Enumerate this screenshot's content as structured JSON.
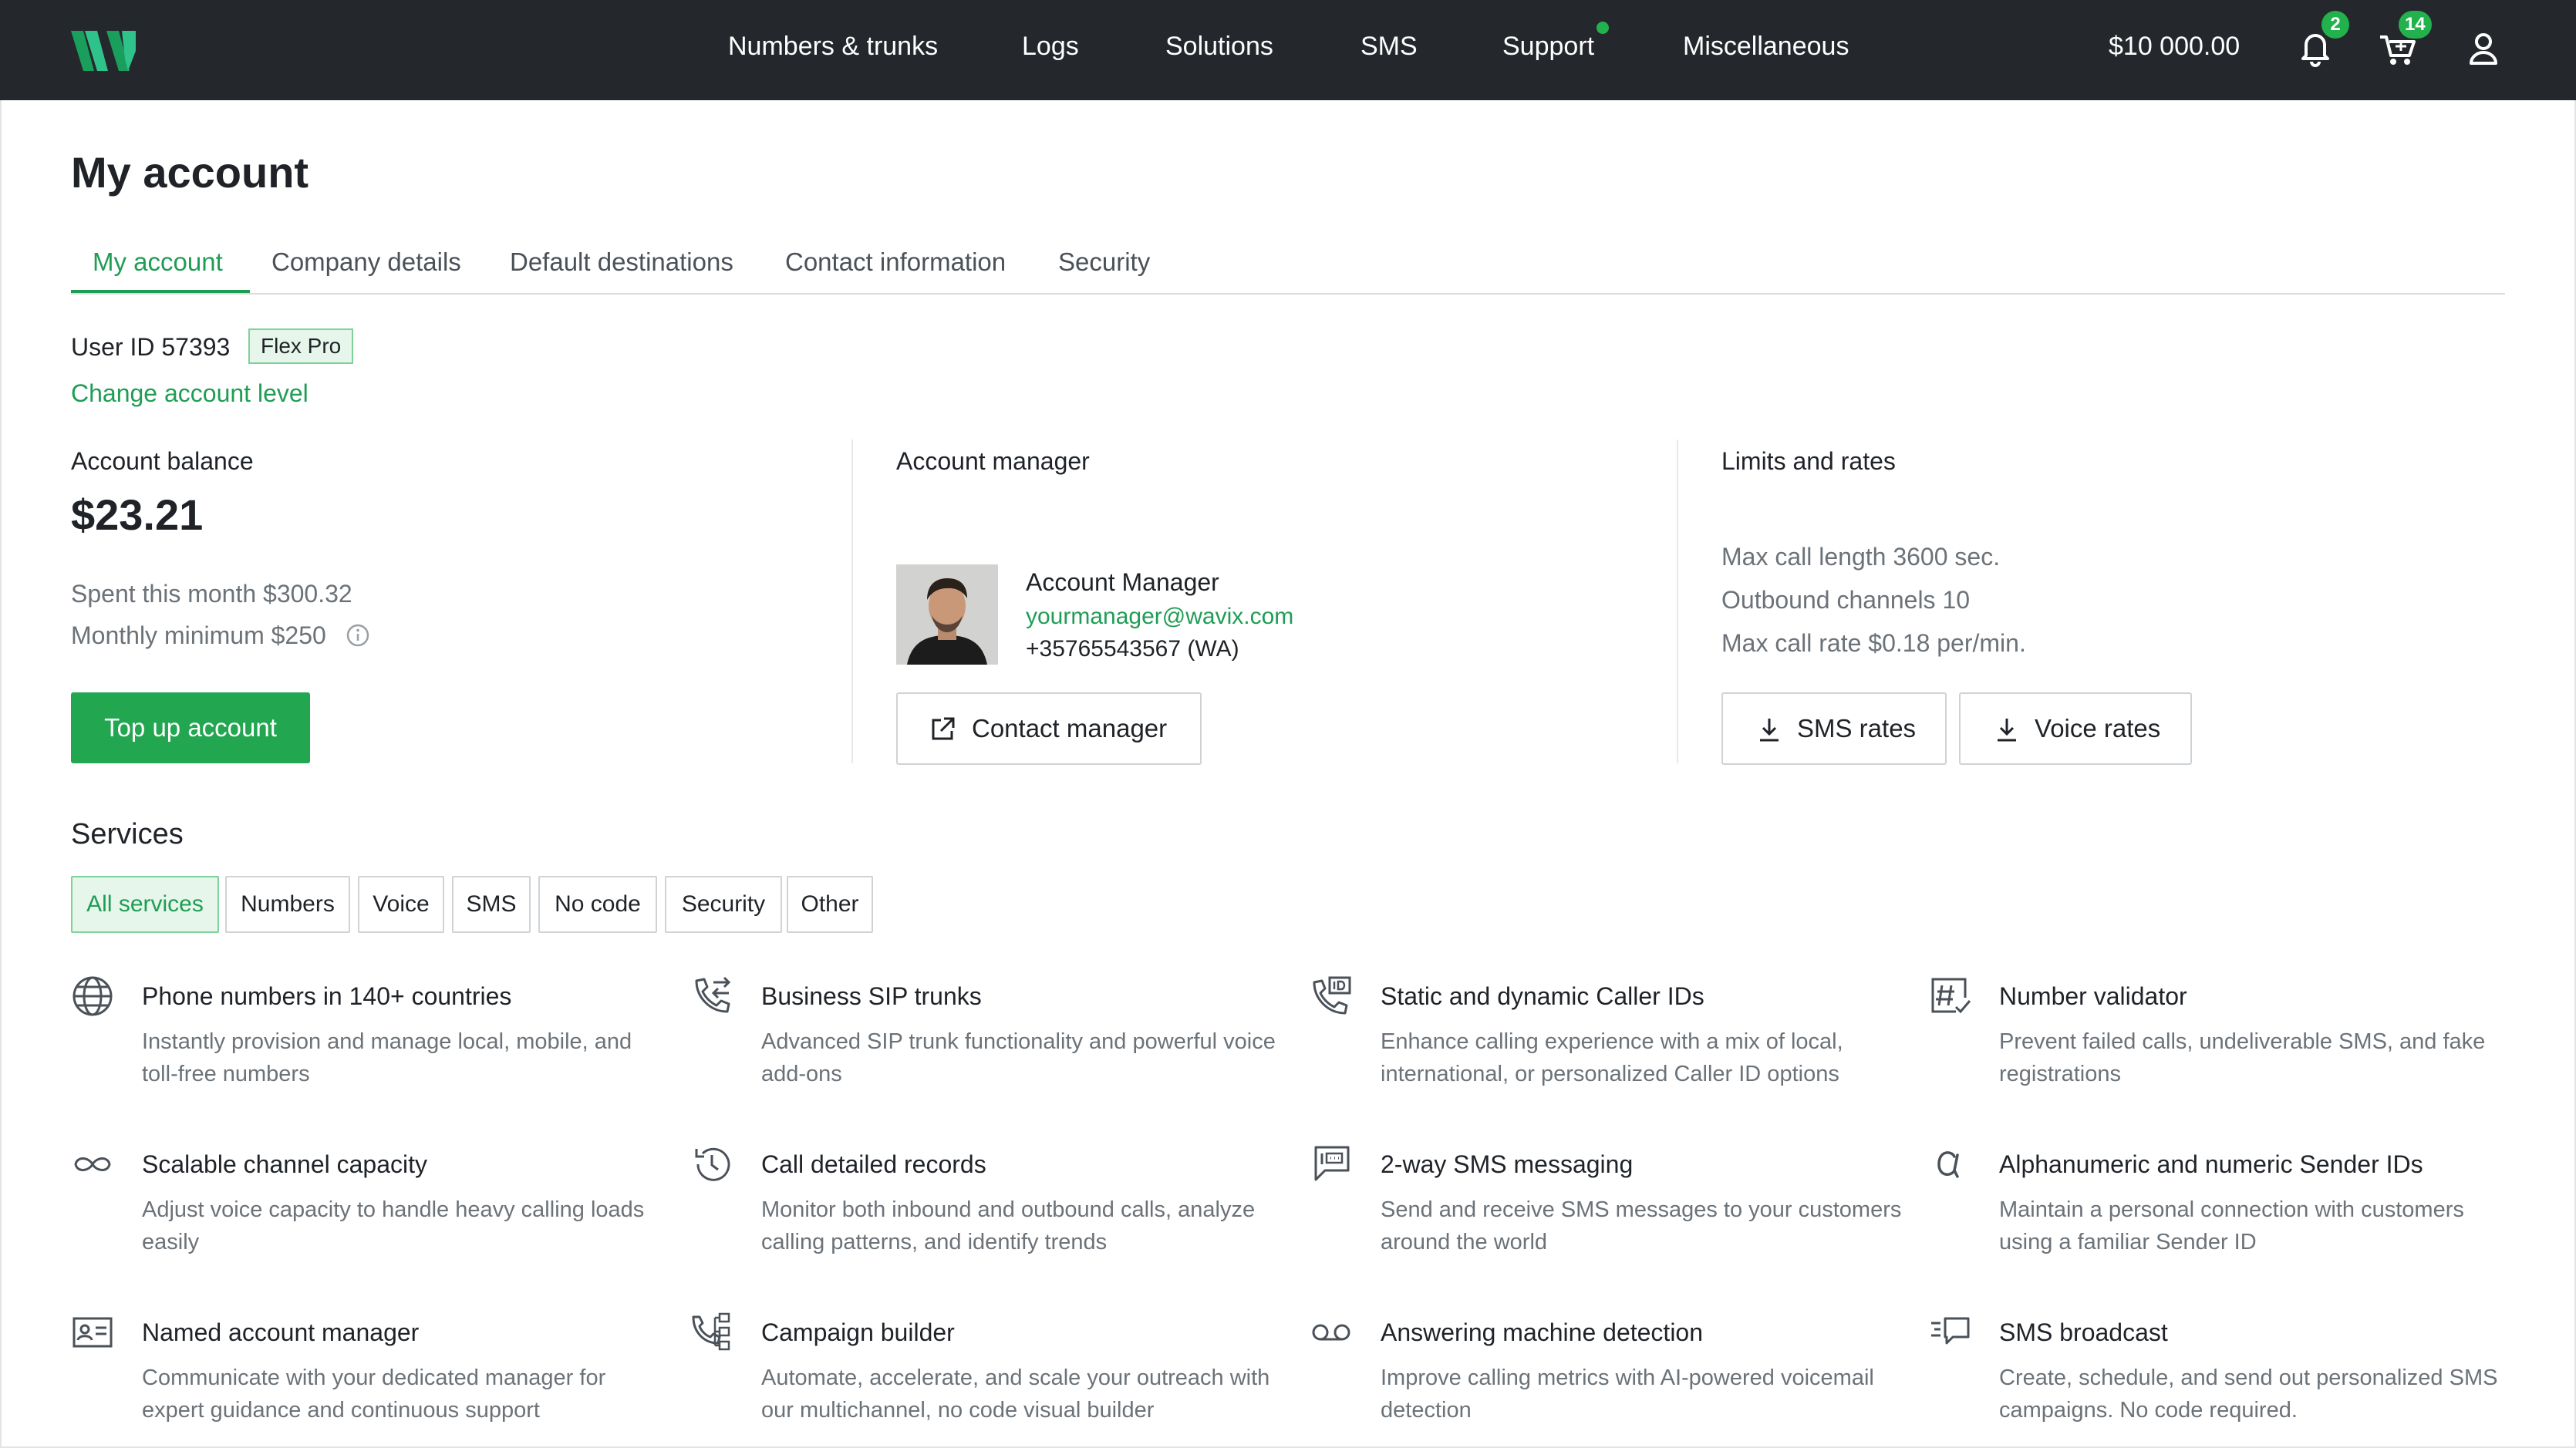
{
  "topbar": {
    "nav": [
      "Numbers & trunks",
      "Logs",
      "Solutions",
      "SMS",
      "Support",
      "Miscellaneous"
    ],
    "balance": "$10 000.00",
    "notifications_count": "2",
    "cart_count": "14",
    "icons": [
      "bell-icon",
      "cart-icon",
      "user-icon"
    ],
    "accent": "#22b14c",
    "background": "#24282c"
  },
  "page": {
    "title": "My account",
    "tabs": [
      "My account",
      "Company details",
      "Default destinations",
      "Contact information",
      "Security"
    ],
    "active_tab": "My account"
  },
  "account": {
    "user_id_label": "User ID 57393",
    "plan": "Flex Pro",
    "change_level": "Change account level"
  },
  "balance": {
    "label": "Account balance",
    "amount": "$23.21",
    "spent": "Spent this month $300.32",
    "minimum": "Monthly minimum $250",
    "top_up": "Top up account"
  },
  "manager": {
    "label": "Account manager",
    "name": "Account Manager",
    "email": "yourmanager@wavix.com",
    "phone": "+35765543567 (WA)",
    "contact_button": "Contact manager"
  },
  "limits": {
    "label": "Limits and rates",
    "max_call_length": "Max call length 3600 sec.",
    "outbound_channels": "Outbound channels 10",
    "max_call_rate": "Max call rate $0.18 per/min.",
    "sms_rates": "SMS rates",
    "voice_rates": "Voice rates"
  },
  "services": {
    "title": "Services",
    "filters": [
      "All services",
      "Numbers",
      "Voice",
      "SMS",
      "No code",
      "Security",
      "Other"
    ],
    "active_filter": "All services",
    "items": [
      {
        "title": "Phone numbers in 140+ countries",
        "desc": "Instantly provision and manage local, mobile, and toll-free numbers",
        "icon": "globe-icon"
      },
      {
        "title": "Business SIP trunks",
        "desc": "Advanced SIP trunk functionality and powerful voice add-ons",
        "icon": "phone-transfer-icon"
      },
      {
        "title": "Static and dynamic Caller IDs",
        "desc": "Enhance calling experience with a mix of local, international, or personalized Caller ID options",
        "icon": "caller-id-icon"
      },
      {
        "title": "Number validator",
        "desc": "Prevent failed calls, undeliverable SMS, and fake registrations",
        "icon": "number-validator-icon"
      },
      {
        "title": "Scalable channel capacity",
        "desc": "Adjust voice capacity to handle heavy calling loads easily",
        "icon": "infinity-icon"
      },
      {
        "title": "Call detailed records",
        "desc": "Monitor both inbound and outbound calls, analyze calling patterns, and identify trends",
        "icon": "history-icon"
      },
      {
        "title": "2-way SMS messaging",
        "desc": "Send and receive SMS messages to your customers around the world",
        "icon": "sms-messaging-icon"
      },
      {
        "title": "Alphanumeric and numeric Sender IDs",
        "desc": "Maintain a personal connection with customers using a familiar Sender ID",
        "icon": "alpha-icon"
      },
      {
        "title": "Named account manager",
        "desc": "Communicate with your dedicated manager for expert guidance and continuous support",
        "icon": "id-card-icon"
      },
      {
        "title": "Campaign builder",
        "desc": "Automate, accelerate, and scale your outreach with our multichannel, no code visual builder",
        "icon": "campaign-flow-icon"
      },
      {
        "title": "Answering machine detection",
        "desc": "Improve calling metrics with AI-powered voicemail detection",
        "icon": "voicemail-icon"
      },
      {
        "title": "SMS broadcast",
        "desc": "Create, schedule, and send out personalized SMS campaigns. No code required.",
        "icon": "broadcast-icon"
      }
    ]
  }
}
